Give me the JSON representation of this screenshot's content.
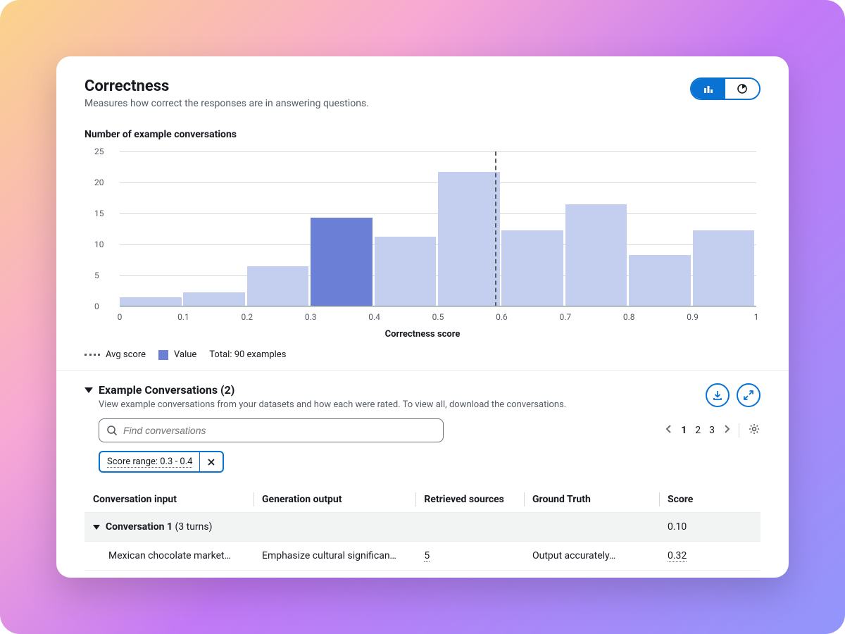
{
  "header": {
    "title": "Correctness",
    "subtitle": "Measures how correct the responses are in answering questions."
  },
  "toggle": {
    "active": "bar",
    "alt": "pie"
  },
  "chart": {
    "title": "Number of example conversations",
    "xaxis_title": "Correctness score"
  },
  "chart_data": {
    "type": "bar",
    "xlabel": "Correctness score",
    "ylabel": "Number of example conversations",
    "ylim": [
      0,
      25
    ],
    "yticks": [
      0,
      5,
      10,
      15,
      20,
      25
    ],
    "bin_edges": [
      0,
      0.1,
      0.2,
      0.3,
      0.4,
      0.5,
      0.6,
      0.7,
      0.8,
      0.9,
      1
    ],
    "values": [
      1.5,
      2.3,
      6.5,
      14.3,
      11.3,
      21.7,
      12.3,
      16.5,
      8.3,
      12.3
    ],
    "highlight_index": 3,
    "avg_score_x": 0.59,
    "legend": {
      "avg": "Avg score",
      "value": "Value",
      "total": "Total: 90 examples"
    }
  },
  "section": {
    "title": "Example Conversations (2)",
    "subtitle": "View example conversations from your datasets and how each were rated. To view all, download the conversations."
  },
  "search": {
    "placeholder": "Find conversations"
  },
  "pager": {
    "pages": [
      "1",
      "2",
      "3"
    ],
    "current": "1"
  },
  "chip": {
    "label": "Score range: 0.3 - 0.4"
  },
  "table": {
    "columns": [
      "Conversation input",
      "Generation output",
      "Retrieved sources",
      "Ground Truth",
      "Score"
    ],
    "group": {
      "name": "Conversation 1",
      "turns": "(3 turns)",
      "score": "0.10"
    },
    "row": {
      "input": "Mexican chocolate market…",
      "output": "Emphasize cultural significan…",
      "sources": "5",
      "truth": "Output accurately…",
      "score": "0.32"
    }
  }
}
